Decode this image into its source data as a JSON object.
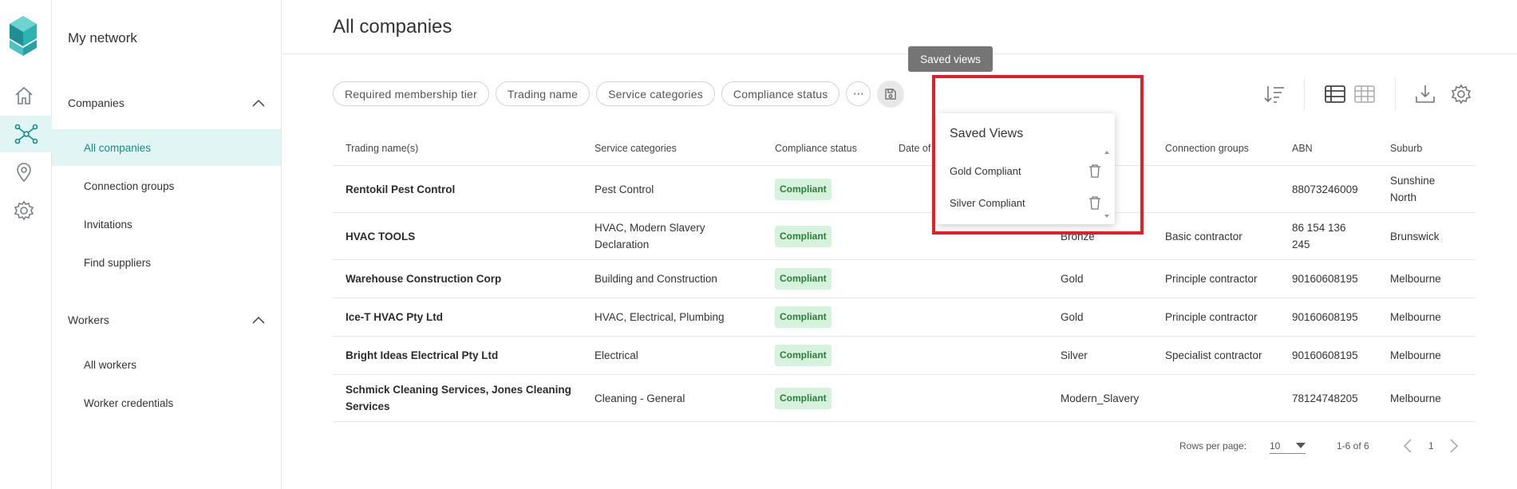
{
  "colors": {
    "accent": "#178a8a",
    "badge_bg": "#d6f2dc",
    "badge_text": "#2e7d3a",
    "highlight": "#d7232e"
  },
  "nav_rail": {
    "items": [
      {
        "icon": "home-icon"
      },
      {
        "icon": "network-icon",
        "active": true
      },
      {
        "icon": "location-pin-icon"
      },
      {
        "icon": "settings-gear-icon"
      }
    ]
  },
  "subnav": {
    "title": "My network",
    "companies_section": "Companies",
    "companies_items": [
      "All companies",
      "Connection groups",
      "Invitations",
      "Find suppliers"
    ],
    "workers_section": "Workers",
    "workers_items": [
      "All workers",
      "Worker credentials"
    ]
  },
  "header": {
    "title": "All companies"
  },
  "filters": {
    "chips": [
      "Required membership tier",
      "Trading name",
      "Service categories",
      "Compliance status"
    ],
    "more_label": "⋯"
  },
  "tooltip": {
    "text": "Saved views"
  },
  "table": {
    "headers": [
      "Trading name(s)",
      "Service categories",
      "Compliance status",
      "Date of",
      "Connection groups",
      "ABN",
      "Suburb"
    ],
    "rows": [
      {
        "name": "Rentokil Pest Control",
        "service": "Pest Control",
        "status": "Compliant",
        "tier": "",
        "group": "",
        "abn": "88073246009",
        "suburb": "Sunshine North"
      },
      {
        "name": "HVAC TOOLS",
        "service": "HVAC, Modern Slavery Declaration",
        "status": "Compliant",
        "tier": "Bronze",
        "group": "Basic contractor",
        "abn": "86 154 136 245",
        "suburb": "Brunswick"
      },
      {
        "name": "Warehouse Construction Corp",
        "service": "Building and Construction",
        "status": "Compliant",
        "tier": "Gold",
        "group": "Principle contractor",
        "abn": "90160608195",
        "suburb": "Melbourne"
      },
      {
        "name": "Ice-T HVAC Pty Ltd",
        "service": "HVAC, Electrical, Plumbing",
        "status": "Compliant",
        "tier": "Gold",
        "group": "Principle contractor",
        "abn": "90160608195",
        "suburb": "Melbourne"
      },
      {
        "name": "Bright Ideas Electrical Pty Ltd",
        "service": "Electrical",
        "status": "Compliant",
        "tier": "Silver",
        "group": "Specialist contractor",
        "abn": "90160608195",
        "suburb": "Melbourne"
      },
      {
        "name": "Schmick Cleaning Services, Jones Cleaning Services",
        "service": "Cleaning - General",
        "status": "Compliant",
        "tier": "Modern_Slavery",
        "group": "",
        "abn": "78124748205",
        "suburb": "Melbourne"
      }
    ]
  },
  "pagination": {
    "rows_label": "Rows per page:",
    "rows_value": "10",
    "range": "1-6 of 6",
    "page": "1"
  },
  "saved_views": {
    "title": "Saved Views",
    "items": [
      "Gold Compliant",
      "Silver Compliant"
    ]
  }
}
